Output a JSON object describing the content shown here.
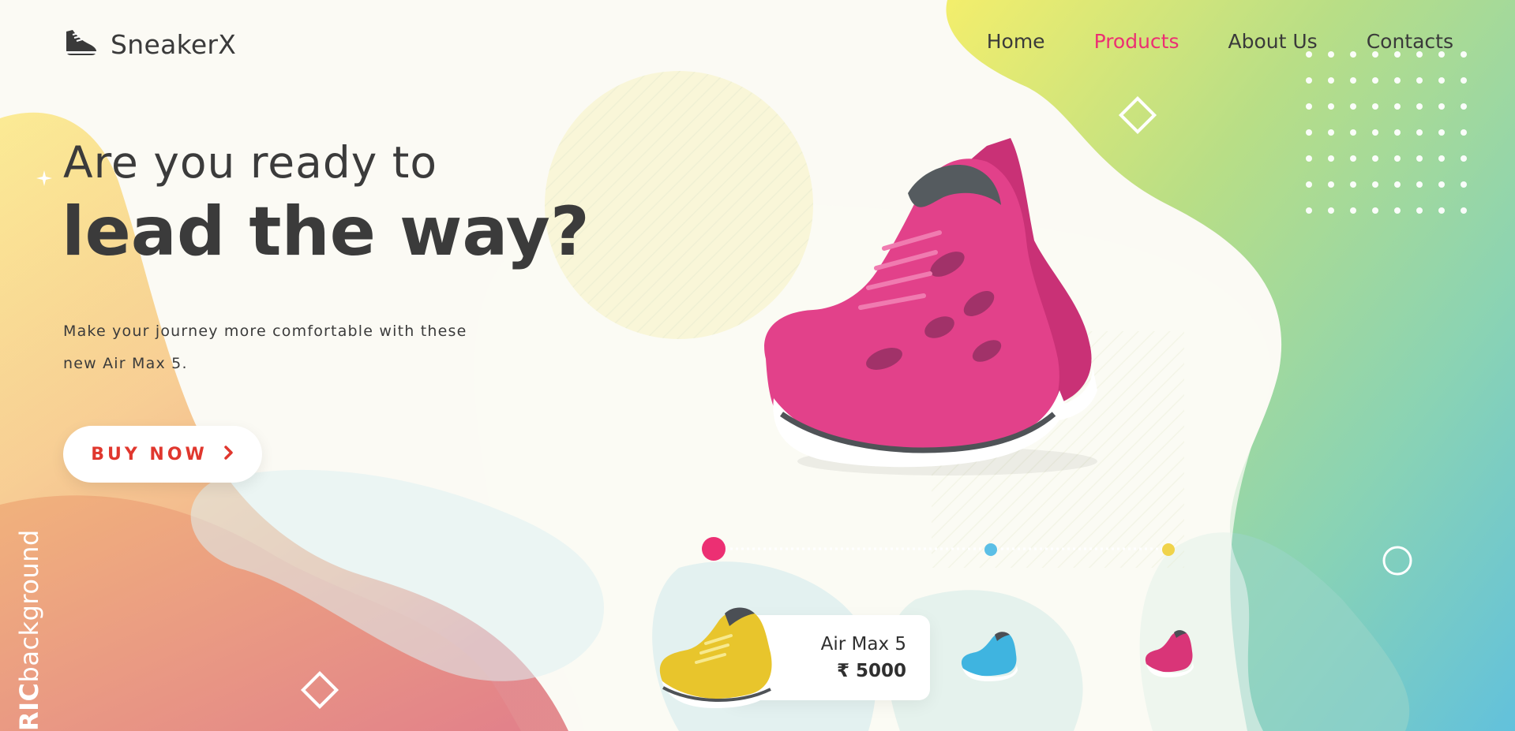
{
  "brand": {
    "name": "SneakerX",
    "icon": "sneaker-icon"
  },
  "nav": {
    "items": [
      {
        "label": "Home",
        "active": false
      },
      {
        "label": "Products",
        "active": true
      },
      {
        "label": "About Us",
        "active": false
      },
      {
        "label": "Contacts",
        "active": false
      }
    ]
  },
  "hero": {
    "line1": "Are you ready to",
    "line2": "lead the way?",
    "subtitle_line1": "Make your journey more comfortable with these",
    "subtitle_line2": "new Air Max 5.",
    "cta_label": "BUY NOW",
    "cta_icon": "chevron-right-icon"
  },
  "side_text": {
    "bold": "RIC",
    "rest": "background"
  },
  "carousel": {
    "dots": [
      {
        "color": "#ec2f73",
        "selected": true
      },
      {
        "color": "#5bbfe6",
        "selected": false
      },
      {
        "color": "#f0d34a",
        "selected": false
      }
    ]
  },
  "product": {
    "name": "Air Max 5",
    "price": "₹ 5000"
  },
  "thumbnails": [
    {
      "name": "yellow-sneaker",
      "color": "#e8c52c"
    },
    {
      "name": "blue-sneaker",
      "color": "#3fb4e0"
    },
    {
      "name": "pink-sneaker",
      "color": "#d93578"
    }
  ],
  "colors": {
    "accent": "#ec2f73",
    "cta_text": "#e0372e",
    "main_shoe": "#e2418a",
    "text": "#3b3b3b"
  }
}
